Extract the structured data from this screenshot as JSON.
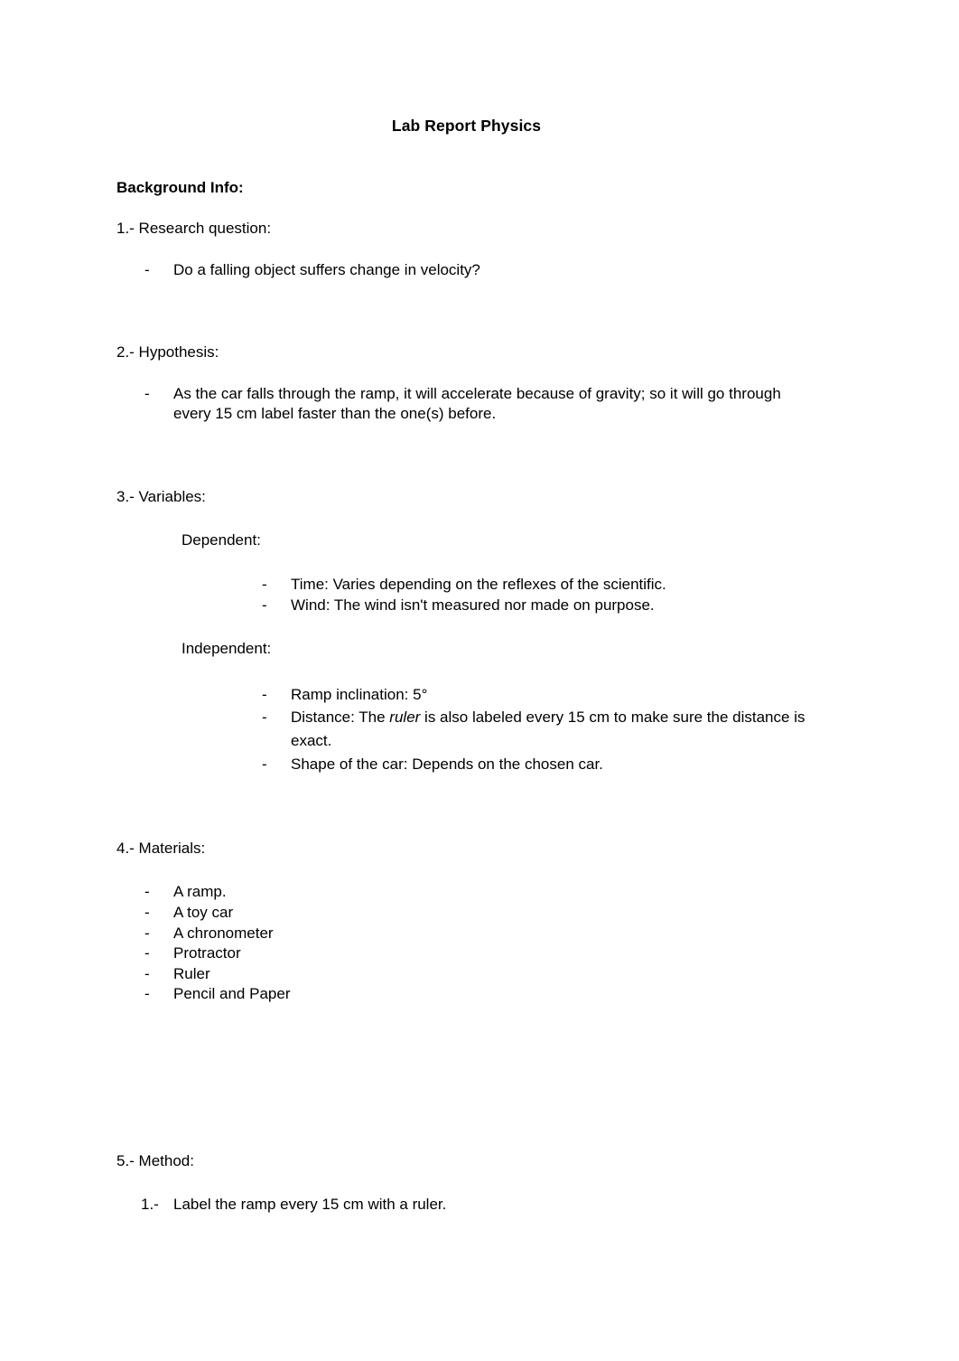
{
  "document": {
    "title": "Lab Report Physics",
    "background_heading": "Background Info:",
    "sections": {
      "research_question": {
        "label": "1.- Research question:",
        "items": [
          "Do a falling object suffers change in velocity?"
        ]
      },
      "hypothesis": {
        "label": "2.- Hypothesis:",
        "items": [
          "As the car falls through the ramp, it will accelerate because of gravity; so it will go through every 15 cm label faster than the one(s) before."
        ]
      },
      "variables": {
        "label": "3.- Variables:",
        "dependent": {
          "label": "Dependent:",
          "items": [
            "Time: Varies depending on the reflexes of the scientific.",
            "Wind: The wind isn't measured nor made on purpose."
          ]
        },
        "independent": {
          "label": "Independent:",
          "items": [
            {
              "pre": "Ramp inclination: 5°",
              "italic": "",
              "post": ""
            },
            {
              "pre": "Distance: The ",
              "italic": "ruler",
              "post": " is also labeled every 15 cm to make sure the distance is exact."
            },
            {
              "pre": "Shape of the car: Depends on the chosen car.",
              "italic": "",
              "post": ""
            }
          ]
        }
      },
      "materials": {
        "label": "4.- Materials:",
        "items": [
          "A ramp.",
          "A toy car",
          "A chronometer",
          "Protractor",
          "Ruler",
          "Pencil and Paper"
        ]
      },
      "method": {
        "label": "5.- Method:",
        "steps": [
          {
            "number": "1.-",
            "text": "Label the ramp every 15 cm with a ruler."
          }
        ]
      }
    },
    "bullet_glyph": "-"
  }
}
